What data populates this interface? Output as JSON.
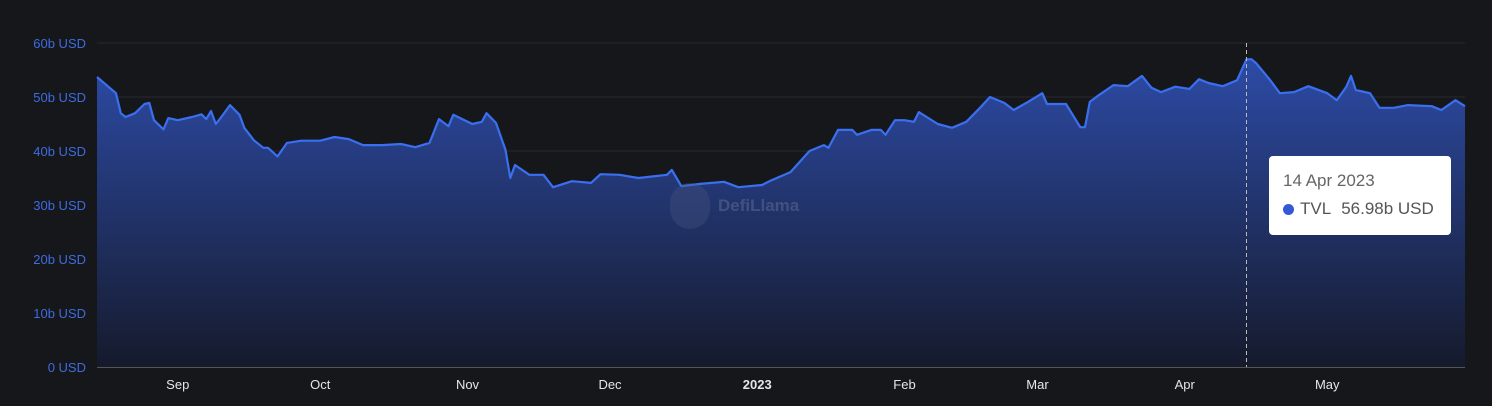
{
  "chart_data": {
    "type": "area",
    "title": "",
    "series_name": "TVL",
    "x_start_date": "2022-08-15",
    "x_unit": "days since x_start_date",
    "xlim_days": [
      0,
      288
    ],
    "ylim": [
      0,
      60
    ],
    "y_unit": "b USD",
    "y_ticks": [
      {
        "value": 0,
        "label": "0 USD"
      },
      {
        "value": 10,
        "label": "10b USD"
      },
      {
        "value": 20,
        "label": "20b USD"
      },
      {
        "value": 30,
        "label": "30b USD"
      },
      {
        "value": 40,
        "label": "40b USD"
      },
      {
        "value": 50,
        "label": "50b USD"
      },
      {
        "value": 60,
        "label": "60b USD"
      }
    ],
    "x_ticks": [
      {
        "day": 17,
        "label": "Sep",
        "bold": false
      },
      {
        "day": 47,
        "label": "Oct",
        "bold": false
      },
      {
        "day": 78,
        "label": "Nov",
        "bold": false
      },
      {
        "day": 108,
        "label": "Dec",
        "bold": false
      },
      {
        "day": 139,
        "label": "2023",
        "bold": true
      },
      {
        "day": 170,
        "label": "Feb",
        "bold": false
      },
      {
        "day": 198,
        "label": "Mar",
        "bold": false
      },
      {
        "day": 229,
        "label": "Apr",
        "bold": false
      },
      {
        "day": 259,
        "label": "May",
        "bold": false
      }
    ],
    "grid": true,
    "points": [
      [
        0,
        53.7
      ],
      [
        2,
        52.2
      ],
      [
        4,
        50.7
      ],
      [
        5,
        47
      ],
      [
        6,
        46.3
      ],
      [
        8,
        47
      ],
      [
        10,
        48.7
      ],
      [
        11,
        48.9
      ],
      [
        12,
        45.7
      ],
      [
        14,
        44
      ],
      [
        15,
        46.1
      ],
      [
        17,
        45.7
      ],
      [
        20,
        46.3
      ],
      [
        22,
        46.8
      ],
      [
        23,
        45.9
      ],
      [
        24,
        47.4
      ],
      [
        25,
        45
      ],
      [
        26,
        46.1
      ],
      [
        28,
        48.5
      ],
      [
        30,
        46.7
      ],
      [
        31,
        44.3
      ],
      [
        33,
        42
      ],
      [
        35,
        40.6
      ],
      [
        36,
        40.6
      ],
      [
        38,
        39
      ],
      [
        40,
        41.5
      ],
      [
        43,
        41.9
      ],
      [
        47,
        41.9
      ],
      [
        50,
        42.6
      ],
      [
        53,
        42.2
      ],
      [
        56,
        41.1
      ],
      [
        60,
        41.1
      ],
      [
        64,
        41.3
      ],
      [
        67,
        40.7
      ],
      [
        70,
        41.5
      ],
      [
        72,
        45.9
      ],
      [
        74,
        44.6
      ],
      [
        75,
        46.7
      ],
      [
        79,
        45
      ],
      [
        81,
        45.4
      ],
      [
        82,
        47
      ],
      [
        84,
        45.2
      ],
      [
        86,
        40.2
      ],
      [
        87,
        35
      ],
      [
        88,
        37.4
      ],
      [
        91,
        35.6
      ],
      [
        94,
        35.6
      ],
      [
        96,
        33.3
      ],
      [
        100,
        34.4
      ],
      [
        104,
        34.1
      ],
      [
        106,
        35.7
      ],
      [
        110,
        35.6
      ],
      [
        114,
        35
      ],
      [
        120,
        35.6
      ],
      [
        121,
        36.5
      ],
      [
        123,
        33.5
      ],
      [
        127,
        33.9
      ],
      [
        132,
        34.3
      ],
      [
        135,
        33.3
      ],
      [
        140,
        33.7
      ],
      [
        142,
        34.6
      ],
      [
        146,
        36.1
      ],
      [
        150,
        40
      ],
      [
        153,
        41.1
      ],
      [
        154,
        40.6
      ],
      [
        156,
        43.9
      ],
      [
        159,
        43.9
      ],
      [
        160,
        43
      ],
      [
        163,
        43.9
      ],
      [
        165,
        43.9
      ],
      [
        166,
        43
      ],
      [
        168,
        45.7
      ],
      [
        170,
        45.7
      ],
      [
        172,
        45.4
      ],
      [
        173,
        47.2
      ],
      [
        177,
        45
      ],
      [
        180,
        44.3
      ],
      [
        183,
        45.4
      ],
      [
        186,
        48.1
      ],
      [
        188,
        50
      ],
      [
        191,
        48.9
      ],
      [
        193,
        47.6
      ],
      [
        196,
        49.1
      ],
      [
        199,
        50.7
      ],
      [
        200,
        48.7
      ],
      [
        204,
        48.7
      ],
      [
        207,
        44.4
      ],
      [
        208,
        44.4
      ],
      [
        209,
        49.1
      ],
      [
        211,
        50.4
      ],
      [
        214,
        52.2
      ],
      [
        217,
        52
      ],
      [
        220,
        53.9
      ],
      [
        222,
        51.7
      ],
      [
        224,
        50.9
      ],
      [
        227,
        51.9
      ],
      [
        230,
        51.5
      ],
      [
        232,
        53.3
      ],
      [
        234,
        52.6
      ],
      [
        237,
        52
      ],
      [
        240,
        53.1
      ],
      [
        242,
        56.98
      ],
      [
        243,
        57
      ],
      [
        244,
        56.3
      ],
      [
        247,
        53.1
      ],
      [
        249,
        50.7
      ],
      [
        252,
        50.9
      ],
      [
        255,
        52
      ],
      [
        259,
        50.7
      ],
      [
        261,
        49.4
      ],
      [
        263,
        51.9
      ],
      [
        264,
        53.9
      ],
      [
        265,
        51.3
      ],
      [
        268,
        50.7
      ],
      [
        270,
        48
      ],
      [
        273,
        48
      ],
      [
        276,
        48.5
      ],
      [
        281,
        48.3
      ],
      [
        283,
        47.6
      ],
      [
        286,
        49.4
      ],
      [
        288,
        48.3
      ]
    ],
    "tooltip": {
      "day": 242,
      "date": "14 Apr 2023",
      "series": "TVL",
      "value": "56.98b USD"
    },
    "colors": {
      "line": "#3a6ff0",
      "fill_top": "#2d4ba6",
      "fill_bottom": "#151a2c",
      "y_label": "#3d6be0"
    }
  },
  "watermark": "DefiLlama"
}
